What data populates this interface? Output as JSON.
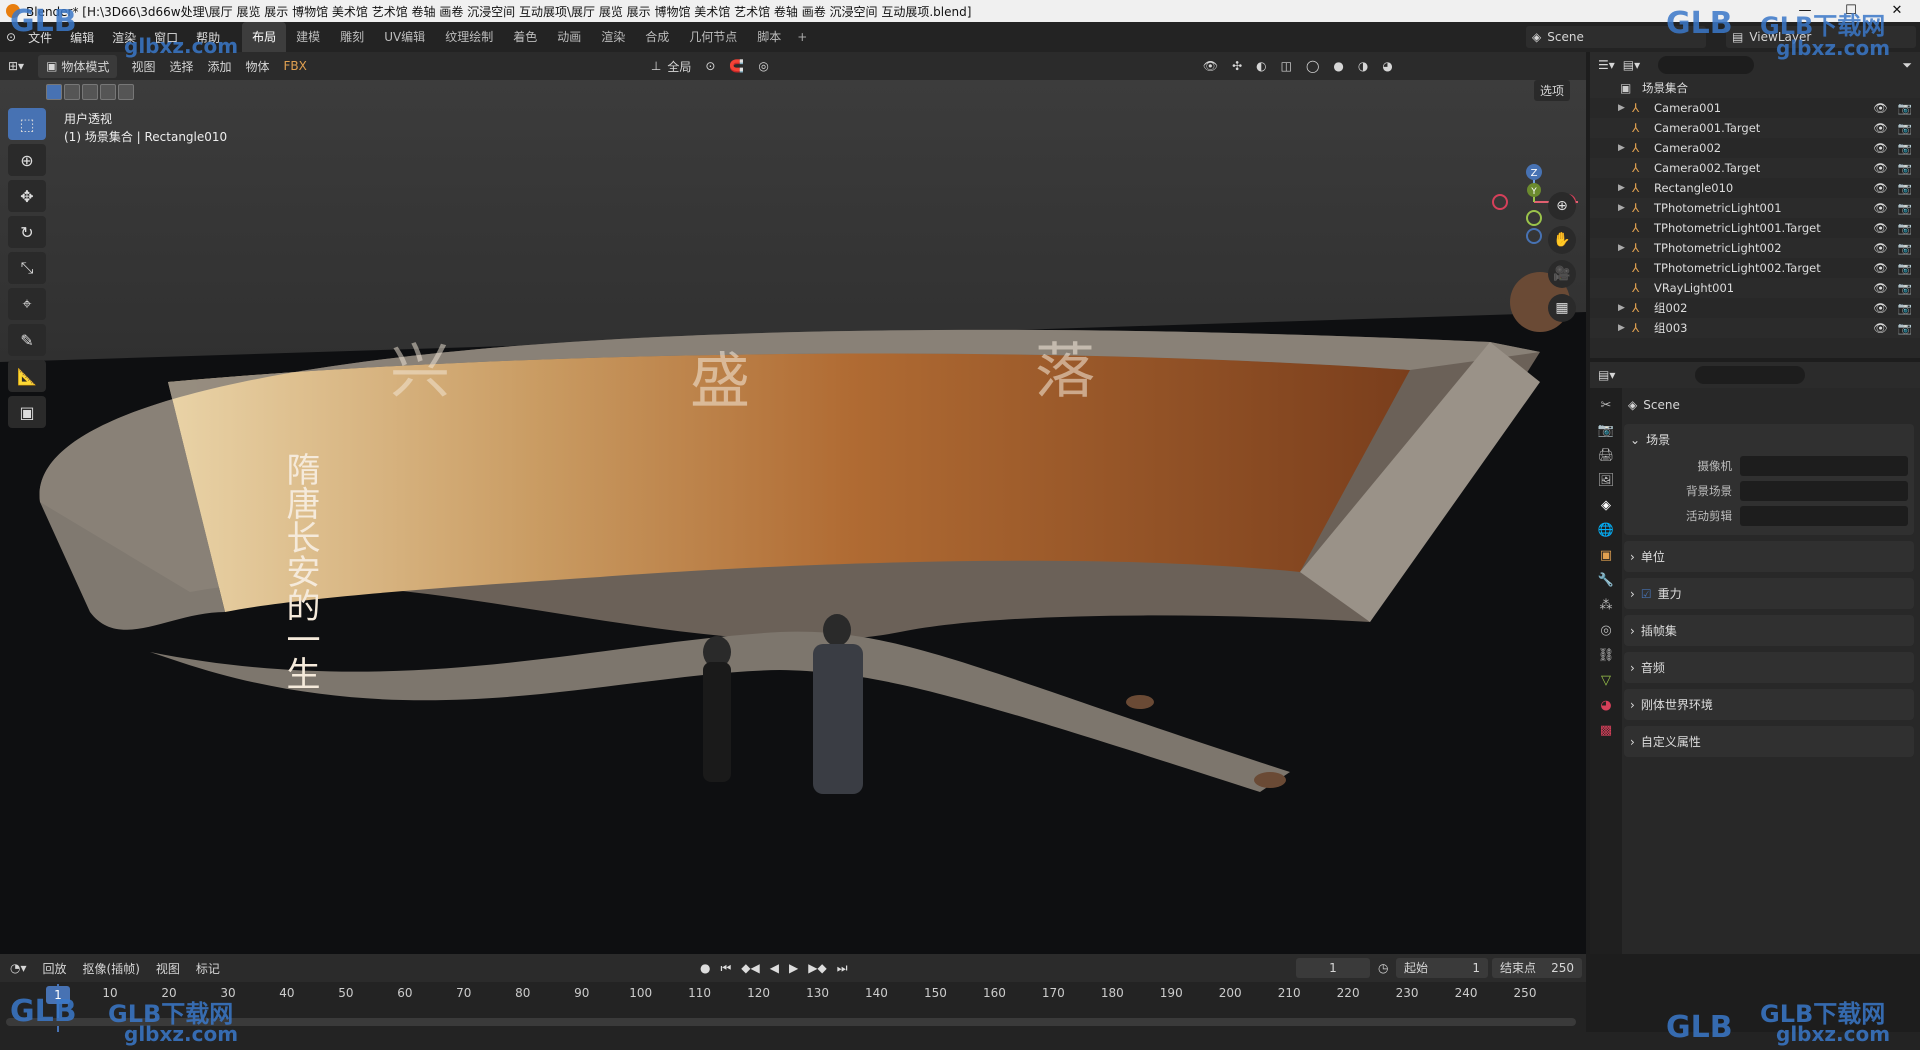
{
  "window": {
    "title": "Blender* [H:\\3D66\\3d66w处理\\展厅 展览 展示 博物馆 美术馆 艺术馆 卷轴 画卷 沉浸空间 互动展项\\展厅 展览 展示 博物馆 美术馆 艺术馆 卷轴 画卷 沉浸空间 互动展项.blend]"
  },
  "menu": [
    "文件",
    "编辑",
    "渲染",
    "窗口",
    "帮助"
  ],
  "workspaces": [
    "布局",
    "建模",
    "雕刻",
    "UV编辑",
    "纹理绘制",
    "着色",
    "动画",
    "渲染",
    "合成",
    "几何节点",
    "脚本"
  ],
  "active_workspace": "布局",
  "scene": {
    "label": "Scene"
  },
  "viewlayer": {
    "label": "ViewLayer"
  },
  "viewport": {
    "mode": "物体模式",
    "menus": [
      "视图",
      "选择",
      "添加",
      "物体"
    ],
    "transform": "全局",
    "options": "选项",
    "info_line1": "用户透视",
    "info_line2": "(1) 场景集合 | Rectangle010",
    "gizmo": {
      "z": "Z",
      "y": "Y",
      "x": "X"
    },
    "scroll_chars": [
      "兴",
      "盛",
      "落"
    ],
    "scroll_side_text": "隋唐长安的一生"
  },
  "outliner": {
    "root": "场景集合",
    "items": [
      {
        "name": "Camera001",
        "expand": true
      },
      {
        "name": "Camera001.Target",
        "expand": false
      },
      {
        "name": "Camera002",
        "expand": true
      },
      {
        "name": "Camera002.Target",
        "expand": false
      },
      {
        "name": "Rectangle010",
        "expand": true
      },
      {
        "name": "TPhotometricLight001",
        "expand": true
      },
      {
        "name": "TPhotometricLight001.Target",
        "expand": false
      },
      {
        "name": "TPhotometricLight002",
        "expand": true
      },
      {
        "name": "TPhotometricLight002.Target",
        "expand": false
      },
      {
        "name": "VRayLight001",
        "expand": false
      },
      {
        "name": "组002",
        "expand": true
      },
      {
        "name": "组003",
        "expand": true
      }
    ]
  },
  "properties": {
    "title": "Scene",
    "panel_scene": "场景",
    "fields": [
      {
        "label": "摄像机",
        "value": ""
      },
      {
        "label": "背景场景",
        "value": ""
      },
      {
        "label": "活动剪辑",
        "value": ""
      }
    ],
    "panels": [
      "单位",
      "重力",
      "插帧集",
      "音频",
      "刚体世界环境",
      "自定义属性"
    ]
  },
  "timeline": {
    "menus": [
      "回放",
      "抠像(插帧)",
      "视图",
      "标记"
    ],
    "current_frame": "1",
    "start_label": "起始",
    "start": "1",
    "end_label": "结束点",
    "end": "250",
    "ticks": [
      "10",
      "20",
      "30",
      "40",
      "50",
      "60",
      "70",
      "80",
      "90",
      "100",
      "110",
      "120",
      "130",
      "140",
      "150",
      "160",
      "170",
      "180",
      "190",
      "200",
      "210",
      "220",
      "230",
      "240",
      "250"
    ],
    "playhead": "1"
  },
  "watermarks": {
    "brand": "GLB下载网",
    "short": "GLB",
    "url": "glbxz.com"
  }
}
